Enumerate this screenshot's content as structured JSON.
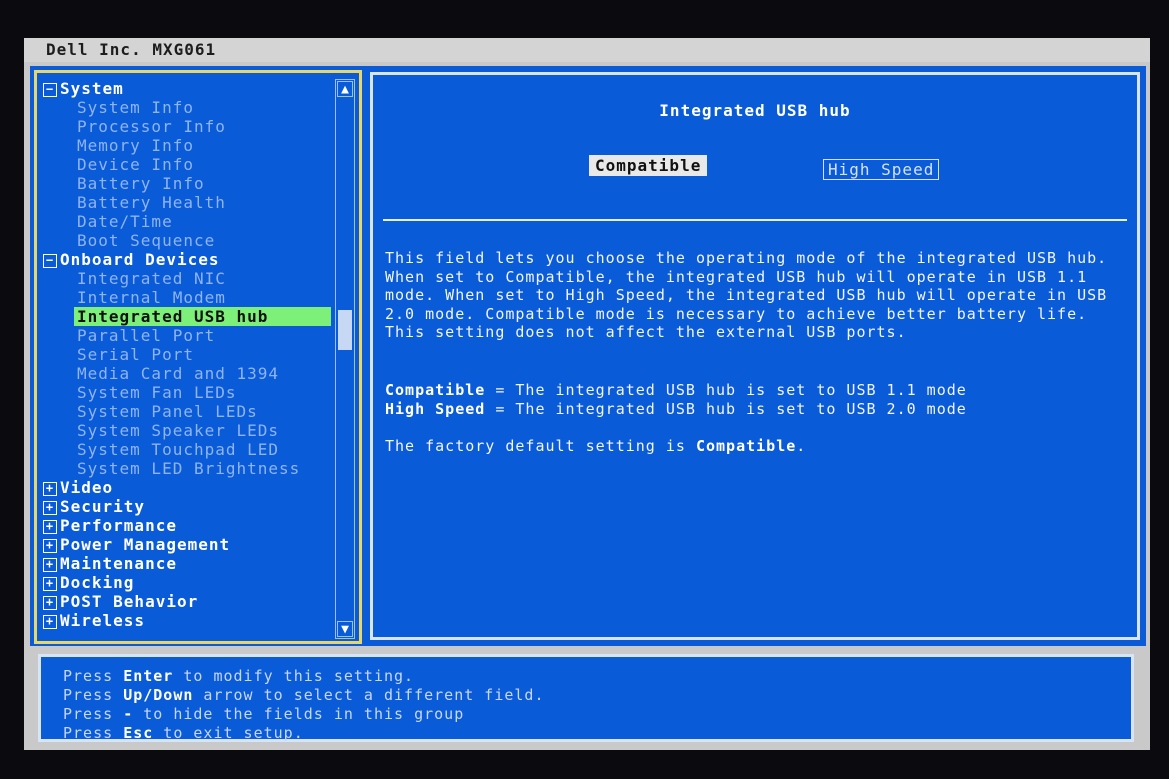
{
  "window": {
    "title": "Dell Inc. MXG061"
  },
  "tree": {
    "items": [
      {
        "label": "System",
        "level": 0,
        "expander": "minus"
      },
      {
        "label": "System Info",
        "level": 1
      },
      {
        "label": "Processor Info",
        "level": 1
      },
      {
        "label": "Memory Info",
        "level": 1
      },
      {
        "label": "Device Info",
        "level": 1
      },
      {
        "label": "Battery Info",
        "level": 1
      },
      {
        "label": "Battery Health",
        "level": 1
      },
      {
        "label": "Date/Time",
        "level": 1
      },
      {
        "label": "Boot Sequence",
        "level": 1
      },
      {
        "label": "Onboard Devices",
        "level": 0,
        "expander": "minus"
      },
      {
        "label": "Integrated NIC",
        "level": 1
      },
      {
        "label": "Internal Modem",
        "level": 1
      },
      {
        "label": "Integrated USB hub",
        "level": 1,
        "selected": true
      },
      {
        "label": "Parallel Port",
        "level": 1
      },
      {
        "label": "Serial Port",
        "level": 1
      },
      {
        "label": "Media Card and 1394",
        "level": 1
      },
      {
        "label": "System Fan LEDs",
        "level": 1
      },
      {
        "label": "System Panel LEDs",
        "level": 1
      },
      {
        "label": "System Speaker LEDs",
        "level": 1
      },
      {
        "label": "System Touchpad LED",
        "level": 1
      },
      {
        "label": "System LED Brightness",
        "level": 1
      },
      {
        "label": "Video",
        "level": 0,
        "expander": "plus"
      },
      {
        "label": "Security",
        "level": 0,
        "expander": "plus"
      },
      {
        "label": "Performance",
        "level": 0,
        "expander": "plus"
      },
      {
        "label": "Power Management",
        "level": 0,
        "expander": "plus"
      },
      {
        "label": "Maintenance",
        "level": 0,
        "expander": "plus"
      },
      {
        "label": "Docking",
        "level": 0,
        "expander": "plus"
      },
      {
        "label": "POST Behavior",
        "level": 0,
        "expander": "plus"
      },
      {
        "label": "Wireless",
        "level": 0,
        "expander": "plus"
      }
    ]
  },
  "detail": {
    "title": "Integrated USB hub",
    "options": {
      "compatible": "Compatible",
      "high_speed": "High Speed",
      "selected": "Compatible"
    },
    "description": "This field lets you choose the operating mode of the integrated USB hub.  When set to Compatible, the integrated USB hub will operate in USB 1.1 mode.  When set to High Speed, the integrated USB hub will operate in USB 2.0 mode.  Compatible mode is necessary to achieve better battery life.  This setting does not affect the external USB ports.",
    "defs": [
      {
        "term": "Compatible",
        "text": " = The integrated USB hub is set to USB 1.1 mode"
      },
      {
        "term": "High Speed",
        "text": " = The integrated USB hub is set to USB 2.0 mode"
      }
    ],
    "default_prefix": "The factory default setting is ",
    "default_value": "Compatible",
    "default_suffix": "."
  },
  "help": [
    {
      "pre": "Press ",
      "key": "Enter",
      "post": " to modify this setting."
    },
    {
      "pre": "Press ",
      "key": "Up/Down",
      "post": " arrow to select a different field."
    },
    {
      "pre": "Press ",
      "key": "-",
      "post": " to hide the fields in this group"
    },
    {
      "pre": "Press ",
      "key": "Esc",
      "post": " to exit setup."
    }
  ],
  "colors": {
    "panel_bg": "#0a5bd8",
    "selection": "#7df07a",
    "tree_border": "#e7d76a"
  },
  "icons": {
    "scroll_up": "arrow-up-icon",
    "scroll_down": "arrow-down-icon",
    "expand": "plus-box-icon",
    "collapse": "minus-box-icon"
  }
}
